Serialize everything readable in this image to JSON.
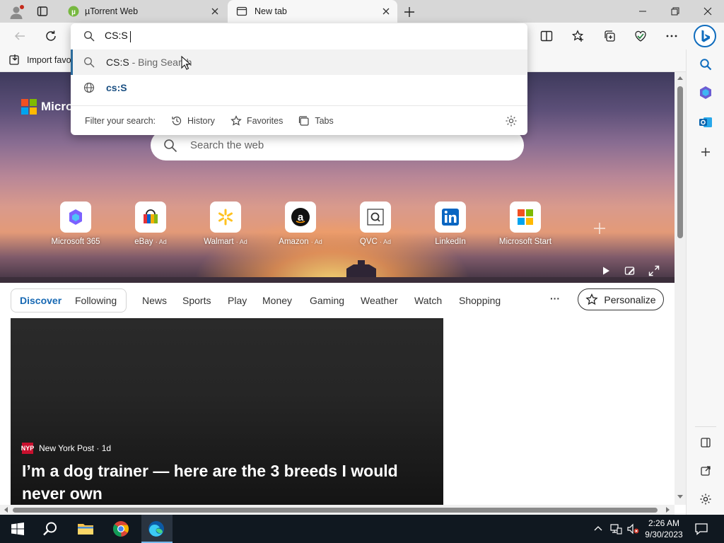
{
  "tabs": [
    {
      "title": "µTorrent Web",
      "active": false
    },
    {
      "title": "New tab",
      "active": true
    }
  ],
  "omnibox": {
    "query": "CS:S",
    "suggestions": [
      {
        "icon": "search-icon",
        "main": "CS:S",
        "sub": " - Bing Search"
      },
      {
        "icon": "globe-icon",
        "main": "cs:S",
        "sub": ""
      }
    ],
    "filter_label": "Filter your search:",
    "filters": [
      "History",
      "Favorites",
      "Tabs"
    ]
  },
  "favorites_bar": {
    "import_label": "Import favo"
  },
  "hero": {
    "brand": "Micro",
    "search_placeholder": "Search the web",
    "quick_links": [
      {
        "label": "Microsoft 365",
        "ad": ""
      },
      {
        "label": "eBay",
        "ad": "· Ad"
      },
      {
        "label": "Walmart",
        "ad": "· Ad"
      },
      {
        "label": "Amazon",
        "ad": "· Ad"
      },
      {
        "label": "QVC",
        "ad": "· Ad"
      },
      {
        "label": "LinkedIn",
        "ad": ""
      },
      {
        "label": "Microsoft Start",
        "ad": ""
      }
    ]
  },
  "feed_nav": {
    "items": [
      "Discover",
      "Following",
      "News",
      "Sports",
      "Play",
      "Money",
      "Gaming",
      "Weather",
      "Watch",
      "Shopping"
    ],
    "more": "···",
    "personalize": "Personalize"
  },
  "article": {
    "source": "New York Post · 1d",
    "source_logo": "NYP",
    "title": "I’m a dog trainer — here are the 3 breeds I would never own"
  },
  "clock": {
    "time": "2:26 AM",
    "date": "9/30/2023"
  },
  "colors": {
    "accent": "#2c6c9c",
    "edge_blue": "#0078d4",
    "taskbar": "#101820"
  }
}
